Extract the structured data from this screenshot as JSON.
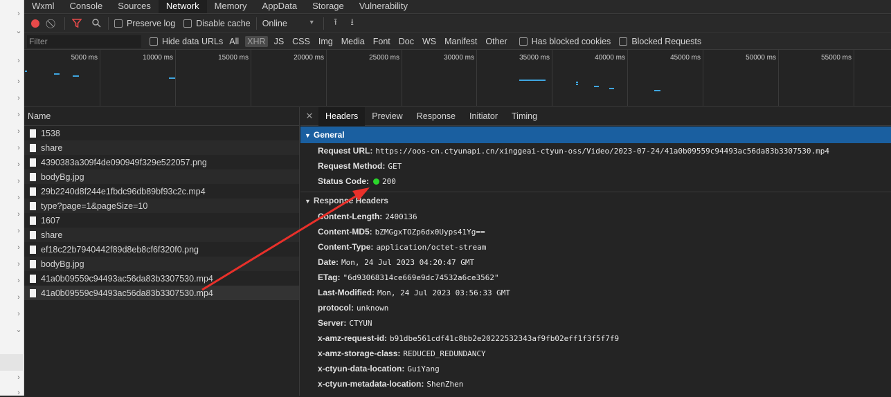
{
  "tabs": [
    "Wxml",
    "Console",
    "Sources",
    "Network",
    "Memory",
    "AppData",
    "Storage",
    "Vulnerability"
  ],
  "active_tab": "Network",
  "toolbar": {
    "preserve_log": "Preserve log",
    "disable_cache": "Disable cache",
    "throttle": "Online"
  },
  "filterbar": {
    "placeholder": "Filter",
    "hide_data_urls": "Hide data URLs",
    "types": [
      "All",
      "XHR",
      "JS",
      "CSS",
      "Img",
      "Media",
      "Font",
      "Doc",
      "WS",
      "Manifest",
      "Other"
    ],
    "active_type": "XHR",
    "has_blocked_cookies": "Has blocked cookies",
    "blocked_requests": "Blocked Requests"
  },
  "overview": {
    "labels": [
      "5000 ms",
      "10000 ms",
      "15000 ms",
      "20000 ms",
      "25000 ms",
      "30000 ms",
      "35000 ms",
      "40000 ms",
      "45000 ms",
      "50000 ms",
      "55000 ms"
    ]
  },
  "requests": {
    "header": "Name",
    "rows": [
      "1538",
      "share",
      "4390383a309f4de090949f329e522057.png",
      "bodyBg.jpg",
      "29b2240d8f244e1fbdc96db89bf93c2c.mp4",
      "type?page=1&pageSize=10",
      "1607",
      "share",
      "ef18c22b7940442f89d8eb8cf6f320f0.png",
      "bodyBg.jpg",
      "41a0b09559c94493ac56da83b3307530.mp4",
      "41a0b09559c94493ac56da83b3307530.mp4"
    ]
  },
  "detail_tabs": [
    "Headers",
    "Preview",
    "Response",
    "Initiator",
    "Timing"
  ],
  "active_detail_tab": "Headers",
  "general": {
    "title": "General",
    "request_url_label": "Request URL:",
    "request_url": "https://oos-cn.ctyunapi.cn/xinggeai-ctyun-oss/Video/2023-07-24/41a0b09559c94493ac56da83b3307530.mp4",
    "request_method_label": "Request Method:",
    "request_method": "GET",
    "status_code_label": "Status Code:",
    "status_code": "200"
  },
  "response_headers": {
    "title": "Response Headers",
    "items": [
      {
        "k": "Content-Length:",
        "v": "2400136"
      },
      {
        "k": "Content-MD5:",
        "v": "bZMGgxTOZp6dx0Uyps41Yg=="
      },
      {
        "k": "Content-Type:",
        "v": "application/octet-stream"
      },
      {
        "k": "Date:",
        "v": "Mon, 24 Jul 2023 04:20:47 GMT"
      },
      {
        "k": "ETag:",
        "v": "\"6d93068314ce669e9dc74532a6ce3562\""
      },
      {
        "k": "Last-Modified:",
        "v": "Mon, 24 Jul 2023 03:56:33 GMT"
      },
      {
        "k": "protocol:",
        "v": "unknown"
      },
      {
        "k": "Server:",
        "v": "CTYUN"
      },
      {
        "k": "x-amz-request-id:",
        "v": "b91dbe561cdf41c8bb2e20222532343af9fb02eff1f3f5f7f9"
      },
      {
        "k": "x-amz-storage-class:",
        "v": "REDUCED_REDUNDANCY"
      },
      {
        "k": "x-ctyun-data-location:",
        "v": "GuiYang"
      },
      {
        "k": "x-ctyun-metadata-location:",
        "v": "ShenZhen"
      }
    ]
  },
  "colors": {
    "accent": "#1a5fa0",
    "status_ok": "#2bd62b",
    "record": "#e84a4a",
    "annotation_arrow": "#e8302a"
  }
}
